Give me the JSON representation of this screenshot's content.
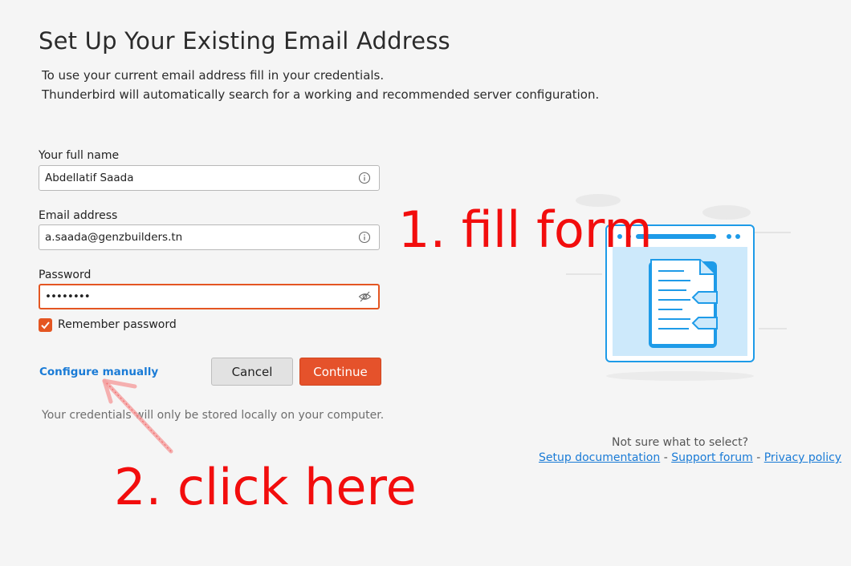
{
  "header": {
    "title": "Set Up Your Existing Email Address",
    "intro_line1": "To use your current email address fill in your credentials.",
    "intro_line2": "Thunderbird will automatically search for a working and recommended server configuration."
  },
  "form": {
    "name_label": "Your full name",
    "name_value": "Abdellatif Saada",
    "name_icon": "info-icon",
    "email_label": "Email address",
    "email_value": "a.saada@genzbuilders.tn",
    "email_icon": "info-icon",
    "password_label": "Password",
    "password_value": "••••••••",
    "password_icon": "eye-slash-icon",
    "remember_label": "Remember password",
    "remember_checked": true
  },
  "actions": {
    "configure_manually": "Configure manually",
    "cancel": "Cancel",
    "continue": "Continue"
  },
  "credentials_note": "Your credentials will only be stored locally on your computer.",
  "help": {
    "question": "Not sure what to select?",
    "setup_documentation": "Setup documentation",
    "separator": "-",
    "support_forum": "Support forum",
    "privacy_policy": "Privacy policy"
  },
  "annotations": {
    "step1": "1. fill form",
    "step2": "2. click here"
  },
  "colors": {
    "accent": "#e5522b",
    "link": "#1a7bd6",
    "annotation": "#f20d0d",
    "illustration_blue": "#1e9be8"
  }
}
